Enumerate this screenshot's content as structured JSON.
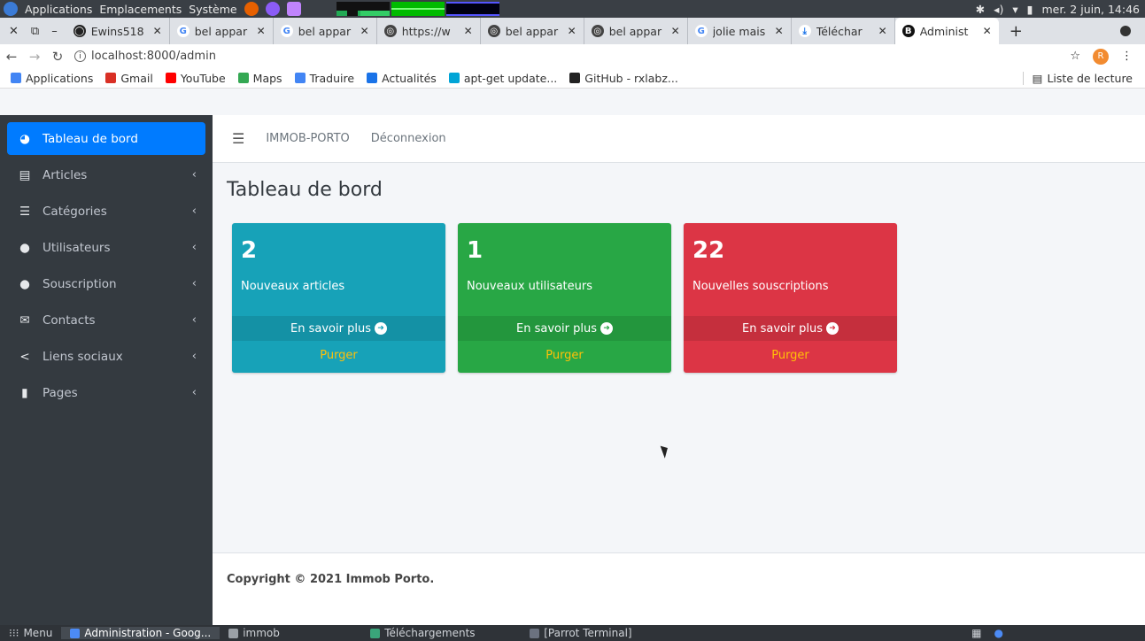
{
  "os_panel": {
    "menus": [
      "Applications",
      "Emplacements",
      "Système"
    ],
    "clock": "mer. 2 juin, 14:46"
  },
  "browser": {
    "tabs": [
      {
        "label": "Ewins518",
        "icon": "github-icon"
      },
      {
        "label": "bel appar",
        "icon": "google-icon"
      },
      {
        "label": "bel appar",
        "icon": "google-icon"
      },
      {
        "label": "https://w",
        "icon": "globe-icon"
      },
      {
        "label": "bel appar",
        "icon": "globe-icon"
      },
      {
        "label": "bel appar",
        "icon": "globe-icon"
      },
      {
        "label": "jolie mais",
        "icon": "google-icon"
      },
      {
        "label": "Téléchar",
        "icon": "download-icon"
      },
      {
        "label": "Administ",
        "icon": "bootstrap-icon",
        "active": true
      }
    ],
    "url": "localhost:8000/admin",
    "profile_initial": "R",
    "bookmarks": [
      {
        "label": "Applications",
        "icon": "apps-grid-icon",
        "color": "#4285f4"
      },
      {
        "label": "Gmail",
        "icon": "gmail-icon",
        "color": "#d93025"
      },
      {
        "label": "YouTube",
        "icon": "youtube-icon",
        "color": "#ff0000"
      },
      {
        "label": "Maps",
        "icon": "maps-icon",
        "color": "#34a853"
      },
      {
        "label": "Traduire",
        "icon": "translate-icon",
        "color": "#4285f4"
      },
      {
        "label": "Actualités",
        "icon": "news-icon",
        "color": "#1a73e8"
      },
      {
        "label": "apt-get update...",
        "icon": "parrot-icon",
        "color": "#00a4d6"
      },
      {
        "label": "GitHub - rxlabz...",
        "icon": "github-icon",
        "color": "#222222"
      }
    ],
    "reading_list": "Liste de lecture"
  },
  "sidebar": {
    "items": [
      {
        "label": "Tableau de bord",
        "icon": "dashboard-icon",
        "active": true
      },
      {
        "label": "Articles",
        "icon": "file-icon"
      },
      {
        "label": "Catégories",
        "icon": "list-icon"
      },
      {
        "label": "Utilisateurs",
        "icon": "user-icon"
      },
      {
        "label": "Souscription",
        "icon": "comment-icon"
      },
      {
        "label": "Contacts",
        "icon": "envelope-icon"
      },
      {
        "label": "Liens sociaux",
        "icon": "share-icon"
      },
      {
        "label": "Pages",
        "icon": "page-icon"
      }
    ]
  },
  "topnav": {
    "brand": "IMMOB-PORTO",
    "logout": "Déconnexion"
  },
  "page": {
    "title": "Tableau de bord",
    "boxes": [
      {
        "number": "2",
        "label": "Nouveaux articles",
        "more": "En savoir plus",
        "purge": "Purger",
        "color": "#17a2b8"
      },
      {
        "number": "1",
        "label": "Nouveaux utilisateurs",
        "more": "En savoir plus",
        "purge": "Purger",
        "color": "#28a745"
      },
      {
        "number": "22",
        "label": "Nouvelles souscriptions",
        "more": "En savoir plus",
        "purge": "Purger",
        "color": "#dc3545"
      }
    ],
    "footer": "Copyright © 2021 Immob Porto."
  },
  "taskbar": {
    "menu": "Menu",
    "tasks": [
      {
        "label": "Administration - Goog...",
        "active": true
      },
      {
        "label": "immob"
      },
      {
        "label": "Téléchargements"
      },
      {
        "label": "[Parrot Terminal]"
      }
    ]
  }
}
